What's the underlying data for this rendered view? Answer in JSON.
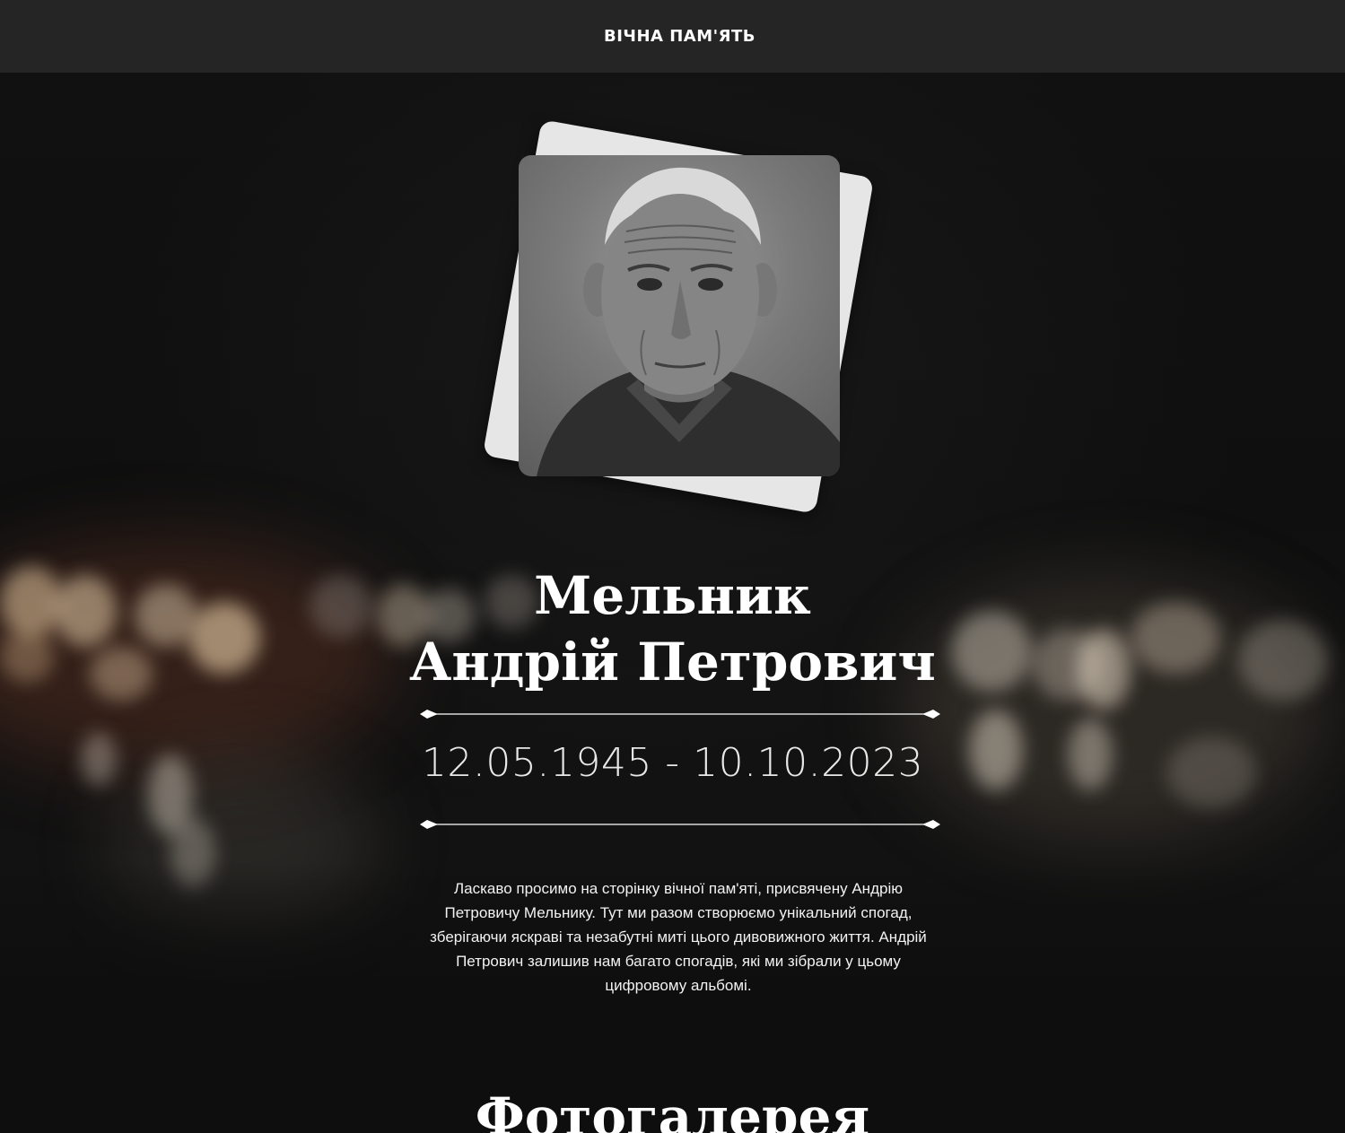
{
  "header": {
    "brand": "ВІЧНА ПАМ'ЯТЬ"
  },
  "hero": {
    "photo_alt": "portrait-photo",
    "surname": "Мельник",
    "given_names": "Андрій Петрович",
    "dates": "12.05.1945 - 10.10.2023",
    "intro": "Ласкаво просимо на сторінку вічної пам'яті, присвячену Андрію Петровичу Мельнику. Тут ми разом створюємо унікальний спогад, зберігаючи яскраві та незабутні миті цього дивовижного життя. Андрій Петрович залишив нам багато спогадів, які ми зібрали у цьому цифровому альбомі."
  },
  "gallery": {
    "title": "Фотогалерея"
  },
  "colors": {
    "topbar": "#252525",
    "background": "#0e0e0e",
    "text": "#ffffff",
    "photo_frame": "#e6e6e6"
  }
}
